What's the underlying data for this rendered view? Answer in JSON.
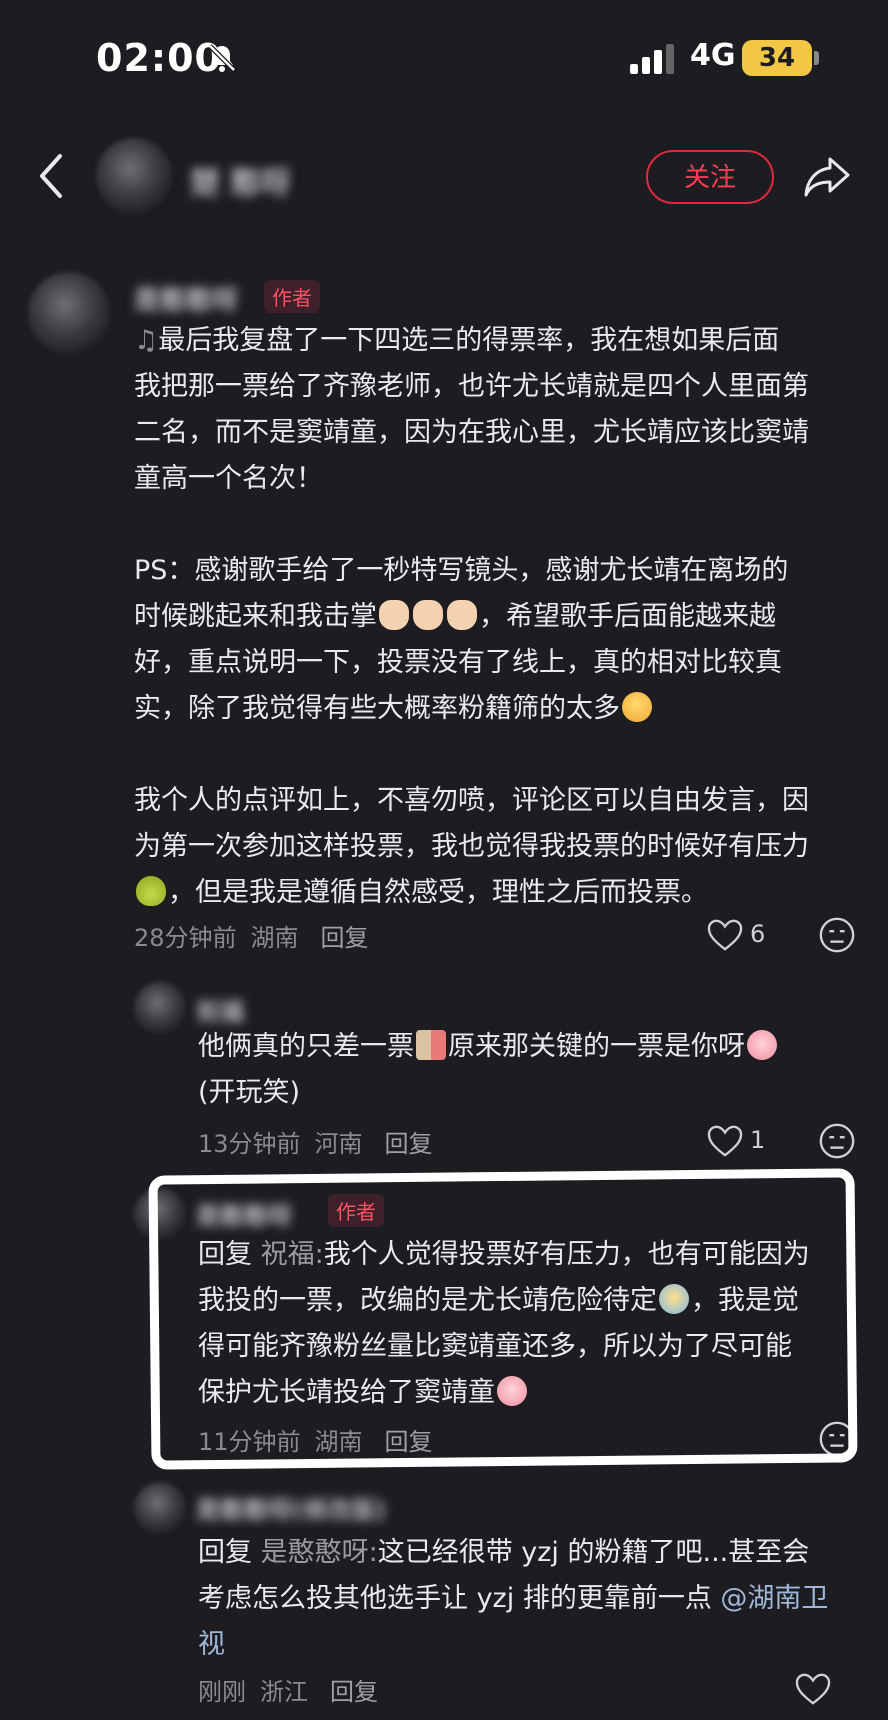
{
  "status_bar": {
    "time": "02:00",
    "network": "4G",
    "battery": "34"
  },
  "header": {
    "follow_label": "关注",
    "username": "楚 憨呀"
  },
  "main_comment": {
    "username": "是憨憨呀",
    "author_badge": "作者",
    "paragraphs": [
      [
        "最后我复盘了一下四选三的得票率，我在想如果后面",
        "我把那一票给了齐豫老师，也许尤长靖就是四个人里面第",
        "二名，而不是窦靖童，因为在我心里，尤长靖应该比窦靖",
        "童高一个名次！"
      ],
      [
        "PS：感谢歌手给了一秒特写镜头，感谢尤长靖在离场的",
        "时候跳起来和我击掌",
        "，希望歌手后面能越来越",
        "好，重点说明一下，投票没有了线上，真的相对比较真",
        "实，除了我觉得有些大概率粉籍筛的太多"
      ],
      [
        "我个人的点评如上，不喜勿喷，评论区可以自由发言，因",
        "为第一次参加这样投票，我也觉得我投票的时候好有压力",
        "，但是我是遵循自然感受，理性之后而投票。"
      ]
    ],
    "time": "28分钟前",
    "location": "湖南",
    "reply_label": "回复",
    "likes": "6"
  },
  "replies": [
    {
      "username": "祝福",
      "lines": [
        "他俩真的只差一票",
        "原来那关键的一票是你呀",
        "(开玩笑)"
      ],
      "time": "13分钟前",
      "location": "河南",
      "reply_label": "回复",
      "likes": "1"
    },
    {
      "username": "是憨憨呀",
      "author_badge": "作者",
      "reply_prefix": "回复",
      "reply_to": "祝福:",
      "lines": [
        "我个人觉得投票好有压力，也有可能因为",
        "我投的一票，改编的是尤长靖危险待定",
        "，我是觉",
        "得可能齐豫粉丝量比窦靖童还多，所以为了尽可能",
        "保护尤长靖投给了窦靖童"
      ],
      "time": "11分钟前",
      "location": "湖南",
      "reply_label": "回复"
    },
    {
      "username": "是憨憨呀(修改版)",
      "reply_prefix": "回复",
      "reply_to": "是憨憨呀:",
      "lines": [
        "这已经很带 yzj 的粉籍了吧...甚至会",
        "考虑怎么投其他选手让 yzj 排的更靠前一点 ",
        "@湖南卫",
        "视"
      ],
      "time": "刚刚",
      "location": "浙江",
      "reply_label": "回复"
    }
  ],
  "colors": {
    "background": "#1c1c21",
    "accent": "#ff3b55",
    "battery": "#f2c744"
  },
  "icons": [
    "back-arrow-icon",
    "share-icon",
    "heart-icon",
    "dislike-face-icon",
    "bell-slash-icon",
    "signal-icon"
  ]
}
